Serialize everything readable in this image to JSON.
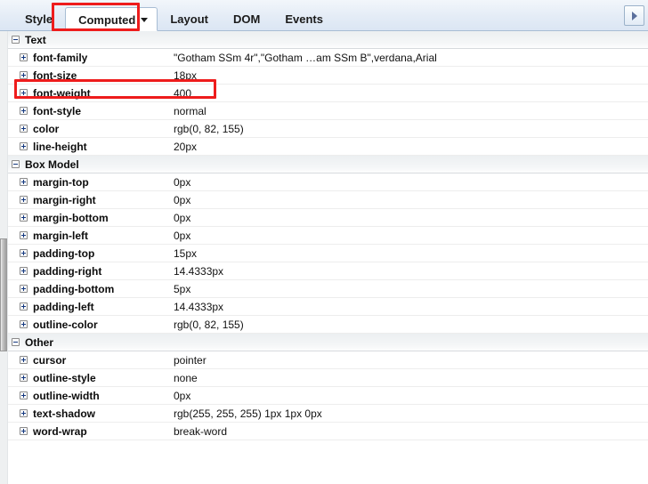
{
  "tabs": {
    "items": [
      {
        "label": "Style",
        "active": false,
        "has_caret": false
      },
      {
        "label": "Computed",
        "active": true,
        "has_caret": true
      },
      {
        "label": "Layout",
        "active": false,
        "has_caret": false
      },
      {
        "label": "DOM",
        "active": false,
        "has_caret": false
      },
      {
        "label": "Events",
        "active": false,
        "has_caret": false
      }
    ],
    "overflow_icon": "triangle-right-icon"
  },
  "sections": [
    {
      "title": "Text",
      "toggle_icon": "minus-box-icon",
      "properties": [
        {
          "name": "font-family",
          "value": "\"Gotham SSm 4r\",\"Gotham …am SSm B\",verdana,Arial"
        },
        {
          "name": "font-size",
          "value": "18px"
        },
        {
          "name": "font-weight",
          "value": "400"
        },
        {
          "name": "font-style",
          "value": "normal"
        },
        {
          "name": "color",
          "value": "rgb(0, 82, 155)"
        },
        {
          "name": "line-height",
          "value": "20px"
        }
      ]
    },
    {
      "title": "Box Model",
      "toggle_icon": "minus-box-icon",
      "properties": [
        {
          "name": "margin-top",
          "value": "0px"
        },
        {
          "name": "margin-right",
          "value": "0px"
        },
        {
          "name": "margin-bottom",
          "value": "0px"
        },
        {
          "name": "margin-left",
          "value": "0px"
        },
        {
          "name": "padding-top",
          "value": "15px"
        },
        {
          "name": "padding-right",
          "value": "14.4333px"
        },
        {
          "name": "padding-bottom",
          "value": "5px"
        },
        {
          "name": "padding-left",
          "value": "14.4333px"
        },
        {
          "name": "outline-color",
          "value": "rgb(0, 82, 155)"
        }
      ]
    },
    {
      "title": "Other",
      "toggle_icon": "minus-box-icon",
      "properties": [
        {
          "name": "cursor",
          "value": "pointer"
        },
        {
          "name": "outline-style",
          "value": "none"
        },
        {
          "name": "outline-width",
          "value": "0px"
        },
        {
          "name": "text-shadow",
          "value": "rgb(255, 255, 255) 1px 1px 0px"
        },
        {
          "name": "word-wrap",
          "value": "break-word"
        }
      ]
    }
  ],
  "annotations": {
    "accent_color": "#ee1c1c",
    "boxes": [
      {
        "id": "annot-computed-tab",
        "target": "Computed"
      },
      {
        "id": "annot-font-weight",
        "target": "font-weight"
      }
    ]
  }
}
